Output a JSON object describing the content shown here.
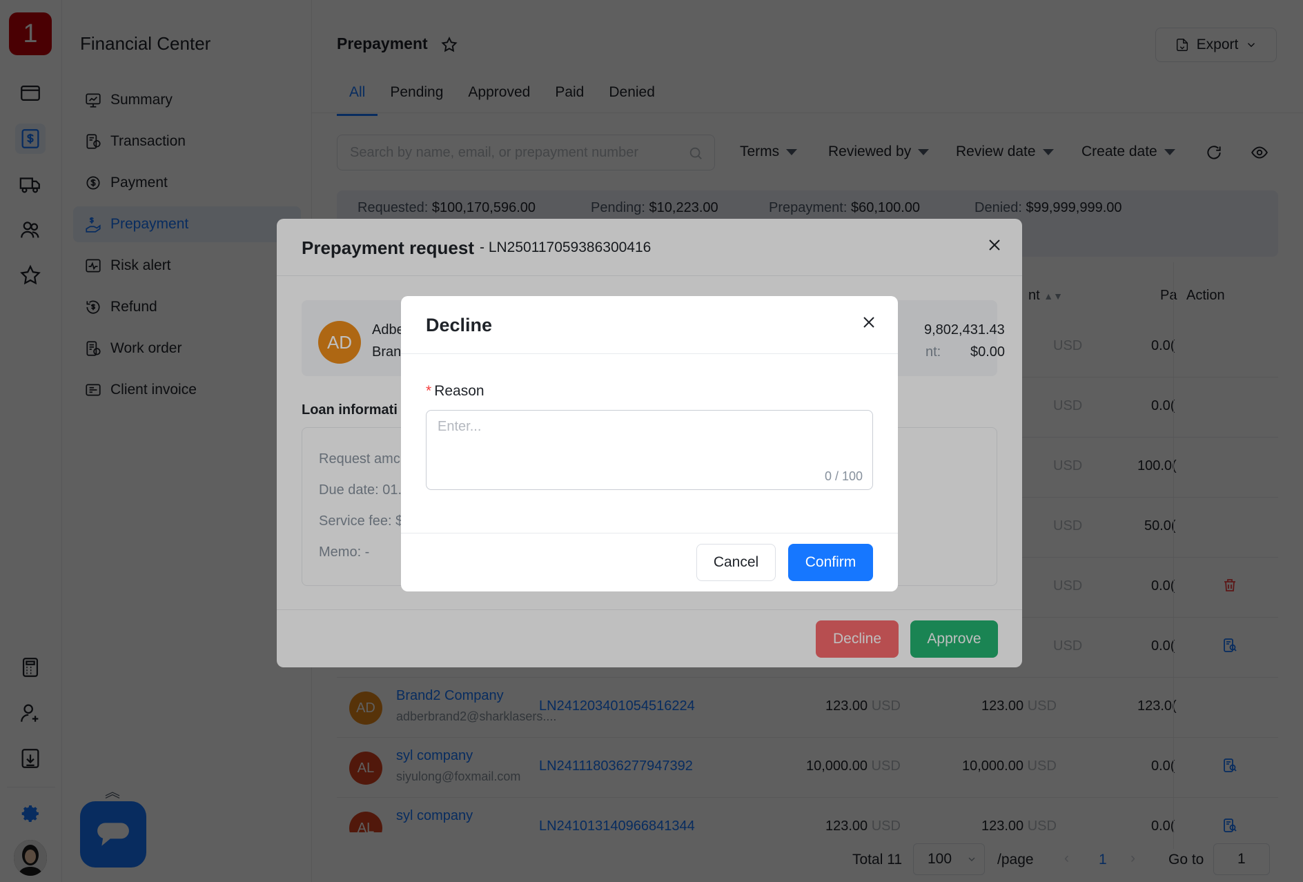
{
  "app": {
    "logo_text": "1"
  },
  "sidebar": {
    "title": "Financial Center",
    "items": [
      {
        "label": "Summary",
        "icon": "chart-screen-icon"
      },
      {
        "label": "Transaction",
        "icon": "document-dollar-icon"
      },
      {
        "label": "Payment",
        "icon": "dollar-cycle-icon"
      },
      {
        "label": "Prepayment",
        "icon": "hand-dollar-icon",
        "active": true
      },
      {
        "label": "Risk alert",
        "icon": "pulse-alert-icon"
      },
      {
        "label": "Refund",
        "icon": "refund-icon"
      },
      {
        "label": "Work order",
        "icon": "work-order-icon"
      },
      {
        "label": "Client invoice",
        "icon": "invoice-icon"
      }
    ]
  },
  "header": {
    "title": "Prepayment",
    "export_label": "Export"
  },
  "tabs": [
    "All",
    "Pending",
    "Approved",
    "Paid",
    "Denied"
  ],
  "filters": {
    "search_placeholder": "Search by name, email, or prepayment number",
    "terms": "Terms",
    "reviewed_by": "Reviewed by",
    "review_date": "Review date",
    "create_date": "Create date"
  },
  "summary": {
    "requested_label": "Requested:",
    "requested": "$100,170,596.00",
    "pending_label": "Pending:",
    "pending": "$10,223.00",
    "prepayment_label": "Prepayment:",
    "prepayment": "$60,100.00",
    "denied_label": "Denied:",
    "denied": "$99,999,999.00"
  },
  "table": {
    "headers": {
      "amount_partial": "nt",
      "paid_partial": "Pa",
      "action": "Action"
    },
    "upper_rows": [
      {
        "usd": "USD",
        "paid": "0.0("
      },
      {
        "usd": "USD",
        "paid": "0.0("
      },
      {
        "usd": "USD",
        "paid": "100.0("
      },
      {
        "usd": "USD",
        "paid": "50.0("
      },
      {
        "usd": "USD",
        "paid": "0.0("
      },
      {
        "usd": "USD",
        "paid": "0.0("
      }
    ],
    "rows": [
      {
        "initials": "AD",
        "company": "Brand2 Company",
        "email": "adberbrand2@sharklasers....",
        "number": "LN241203401054516224",
        "request": "123.00",
        "amount": "123.00",
        "paid": "123.0(",
        "currency": "USD"
      },
      {
        "initials": "AL",
        "company": "syl company",
        "email": "siyulong@foxmail.com",
        "number": "LN241118036277947392",
        "request": "10,000.00",
        "amount": "10,000.00",
        "paid": "0.0(",
        "currency": "USD"
      },
      {
        "initials": "AL",
        "company": "syl company",
        "email": "",
        "number": "LN241013140966841344",
        "request": "123.00",
        "amount": "123.00",
        "paid": "0.0(",
        "currency": "USD"
      }
    ]
  },
  "pagination": {
    "total": "Total 11",
    "page_size": "100",
    "per_page": "/page",
    "current": "1",
    "goto_label": "Go to",
    "goto_value": "1"
  },
  "prepayment_modal": {
    "title": "Prepayment request",
    "number": "- LN250117059386300416",
    "avatar": "AD",
    "name_partial": "Adbe",
    "brand_partial": "Bran",
    "amount_partial": "9,802,431.43",
    "amount2_label_partial": "nt:",
    "amount2": "$0.00",
    "section_title": "Loan informati",
    "request_amount_partial": "Request amc",
    "due_date_partial": "Due date: 01.",
    "service_fee_partial": "Service fee: $",
    "memo": "Memo: -",
    "decline_label": "Decline",
    "approve_label": "Approve"
  },
  "decline_modal": {
    "title": "Decline",
    "required_mark": "*",
    "reason_label": "Reason",
    "placeholder": "Enter...",
    "counter": "0 / 100",
    "cancel_label": "Cancel",
    "confirm_label": "Confirm"
  },
  "colors": {
    "accent": "#1677ff",
    "brand": "#c7000b",
    "approve": "#23b06f",
    "decline": "#f5686b"
  }
}
